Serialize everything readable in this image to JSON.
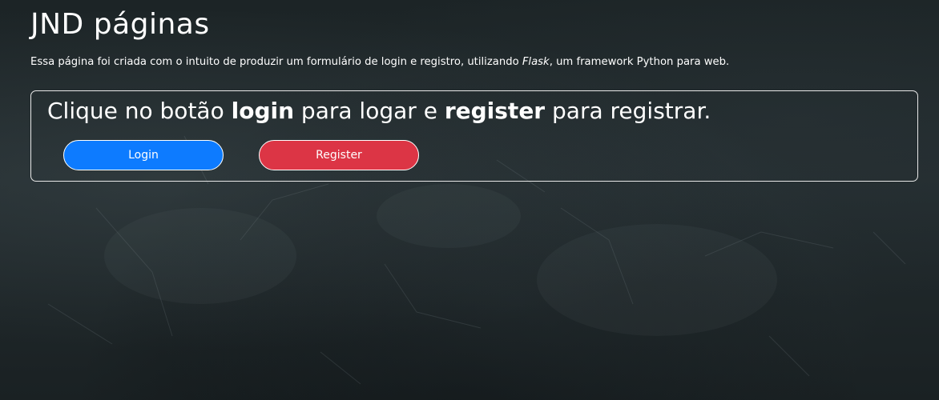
{
  "header": {
    "title": "JND páginas",
    "intro_before": "Essa página foi criada com o intuito de produzir um formulário de login e registro, utilizando ",
    "intro_framework": "Flask",
    "intro_after": ", um framework Python para web."
  },
  "panel": {
    "text_1": "Clique no botão ",
    "strong_1": "login",
    "text_2": " para logar e ",
    "strong_2": "register",
    "text_3": " para registrar.",
    "login_label": "Login",
    "register_label": "Register"
  },
  "colors": {
    "login_button": "#0d7bff",
    "register_button": "#dc3545",
    "background": "#1b2224",
    "text": "#ffffff"
  }
}
